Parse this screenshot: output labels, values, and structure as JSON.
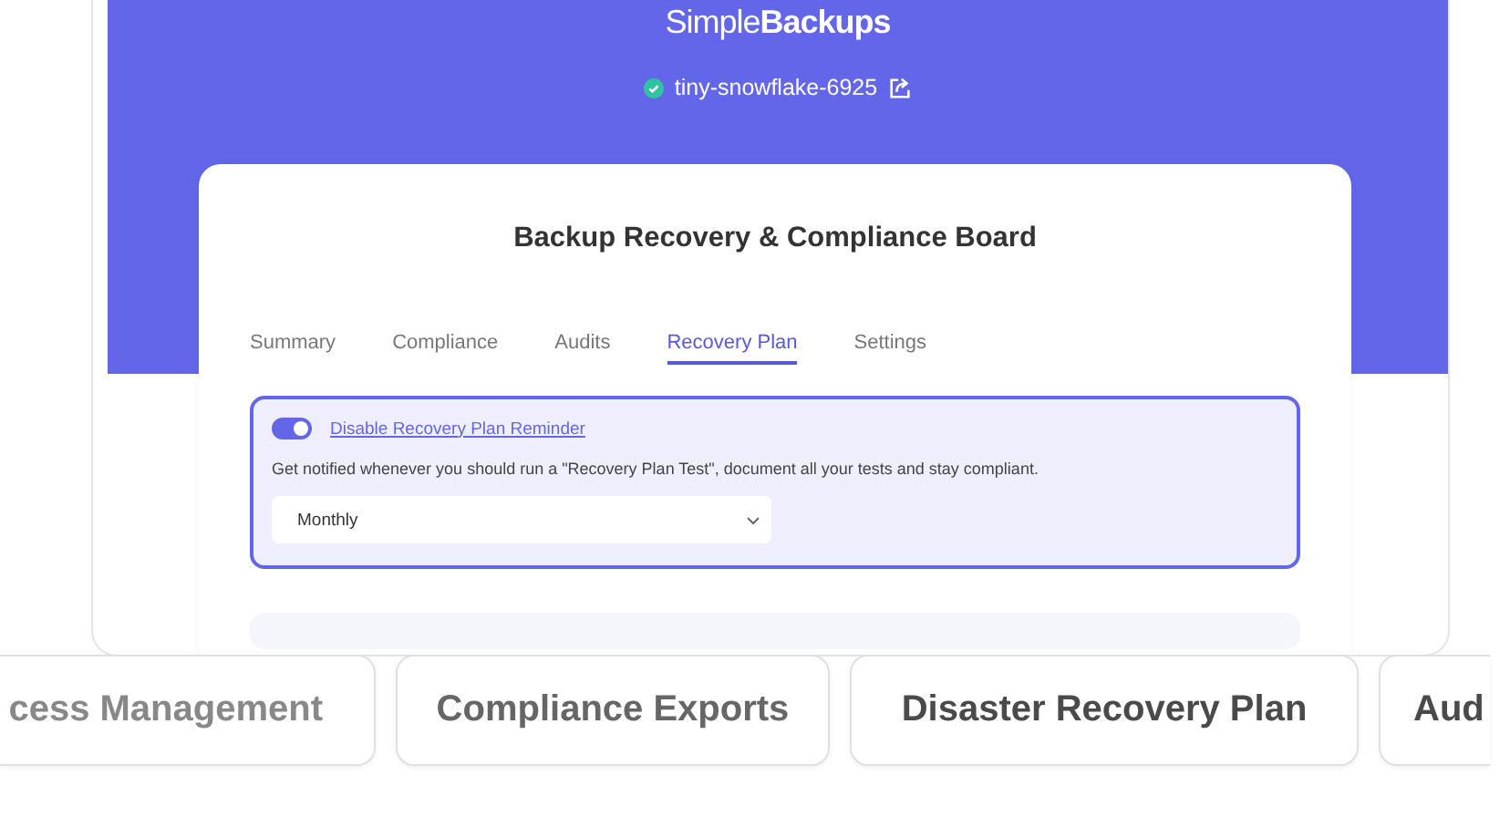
{
  "brand": {
    "light": "Simple",
    "bold": "Backups"
  },
  "server": {
    "name": "tiny-snowflake-6925",
    "status_ok": true
  },
  "card": {
    "title": "Backup Recovery & Compliance Board"
  },
  "tabs": [
    {
      "label": "Summary",
      "selected": false
    },
    {
      "label": "Compliance",
      "selected": false
    },
    {
      "label": "Audits",
      "selected": false
    },
    {
      "label": "Recovery Plan",
      "selected": true
    },
    {
      "label": "Settings",
      "selected": false
    }
  ],
  "reminder": {
    "toggle_on": true,
    "link": "Disable Recovery Plan Reminder",
    "description": "Get notified whenever you should run a \"Recovery Plan Test\", document all your tests and stay compliant.",
    "frequency": "Monthly"
  },
  "features": [
    {
      "label": "cess Management"
    },
    {
      "label": "Compliance Exports"
    },
    {
      "label": "Disaster Recovery Plan"
    },
    {
      "label": "Aud"
    }
  ]
}
